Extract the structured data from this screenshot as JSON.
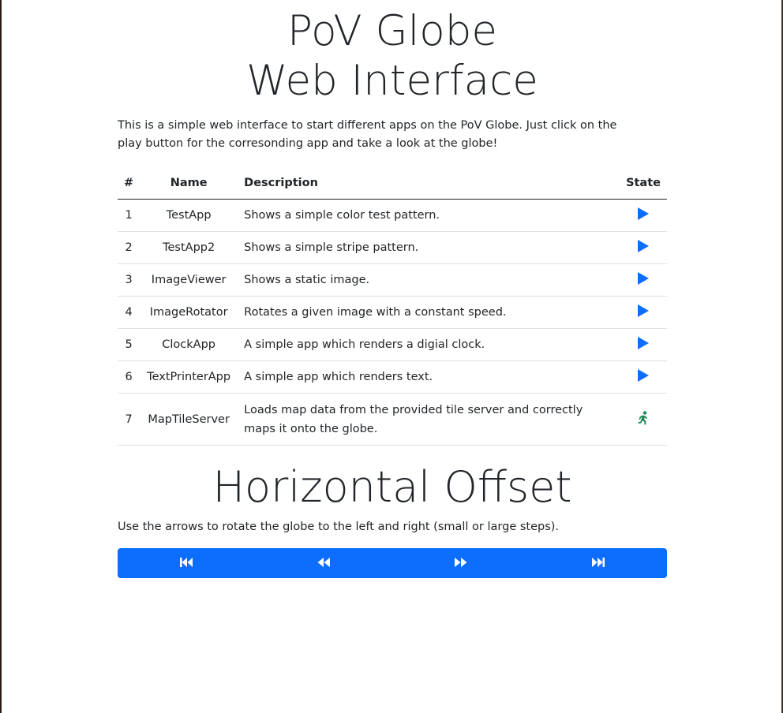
{
  "header": {
    "title_line1": "PoV Globe",
    "title_line2": "Web Interface",
    "intro": "This is a simple web interface to start different apps on the PoV Globe. Just click on the play button for the corresonding app and take a look at the globe!"
  },
  "apps_table": {
    "columns": [
      "#",
      "Name",
      "Description",
      "State"
    ],
    "rows": [
      {
        "num": "1",
        "name": "TestApp",
        "description": "Shows a simple color test pattern.",
        "state": "play-icon"
      },
      {
        "num": "2",
        "name": "TestApp2",
        "description": "Shows a simple stripe pattern.",
        "state": "play-icon"
      },
      {
        "num": "3",
        "name": "ImageViewer",
        "description": "Shows a static image.",
        "state": "play-icon"
      },
      {
        "num": "4",
        "name": "ImageRotator",
        "description": "Rotates a given image with a constant speed.",
        "state": "play-icon"
      },
      {
        "num": "5",
        "name": "ClockApp",
        "description": "A simple app which renders a digial clock.",
        "state": "play-icon"
      },
      {
        "num": "6",
        "name": "TextPrinterApp",
        "description": "A simple app which renders text.",
        "state": "play-icon"
      },
      {
        "num": "7",
        "name": "MapTileServer",
        "description": "Loads map data from the provided tile server and correctly maps it onto the globe.",
        "state": "running-icon"
      }
    ]
  },
  "offset": {
    "title": "Horizontal Offset",
    "hint": "Use the arrows to rotate the globe to the left and right (small or large steps).",
    "buttons": [
      "skip-backward-icon",
      "rewind-icon",
      "fast-forward-icon",
      "skip-forward-icon"
    ]
  },
  "colors": {
    "primary": "#0d6efd",
    "running": "#198754",
    "text": "#212529"
  }
}
